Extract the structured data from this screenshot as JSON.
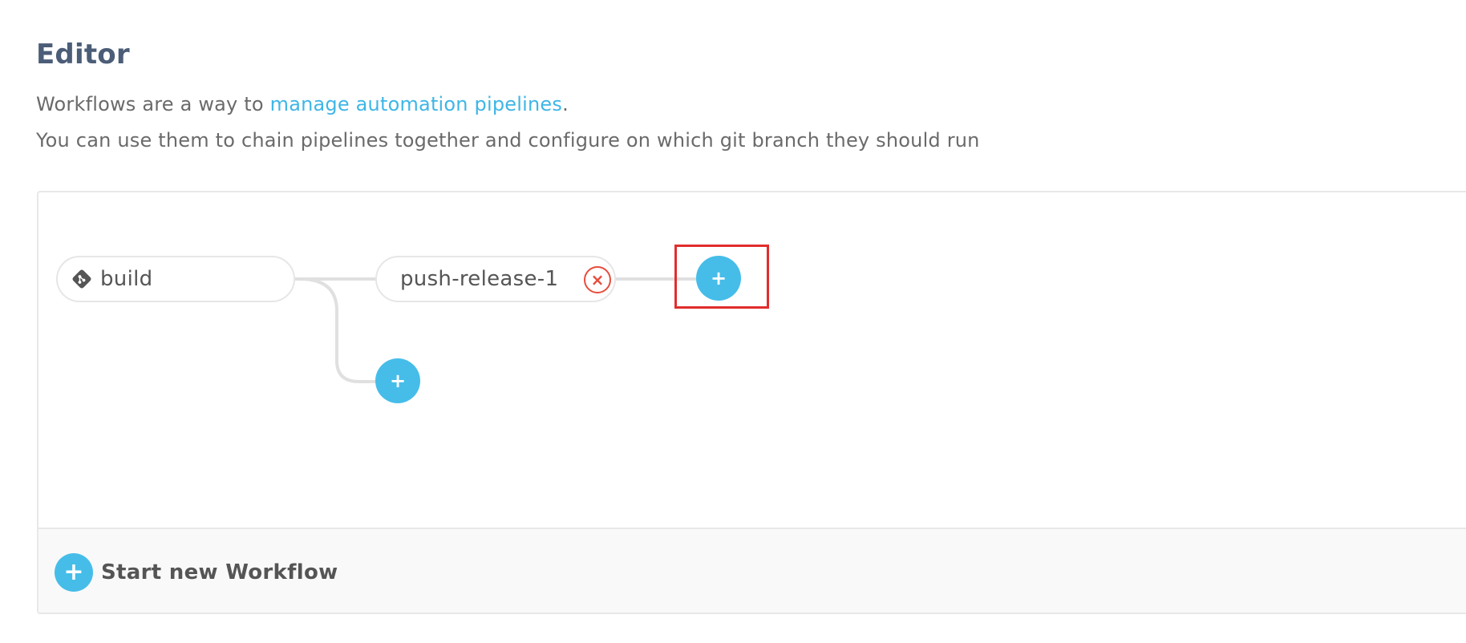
{
  "page": {
    "title": "Editor",
    "description_line1_prefix": "Workflows are a way to ",
    "description_link": "manage automation pipelines",
    "description_line1_suffix": ".",
    "description_line2": "You can use them to chain pipelines together and configure on which git branch they should run"
  },
  "workflow": {
    "nodes": [
      {
        "label": "build",
        "icon": "git-icon"
      },
      {
        "label": "push-release-1",
        "remove_symbol": "×"
      }
    ],
    "add_symbol": "+"
  },
  "footer": {
    "start_symbol": "+",
    "start_label": "Start new Workflow"
  },
  "colors": {
    "accent": "#46bde9",
    "link": "#3fb6e6",
    "danger": "#e74c3c",
    "highlight": "#e12d2d",
    "heading": "#4b5d77"
  }
}
